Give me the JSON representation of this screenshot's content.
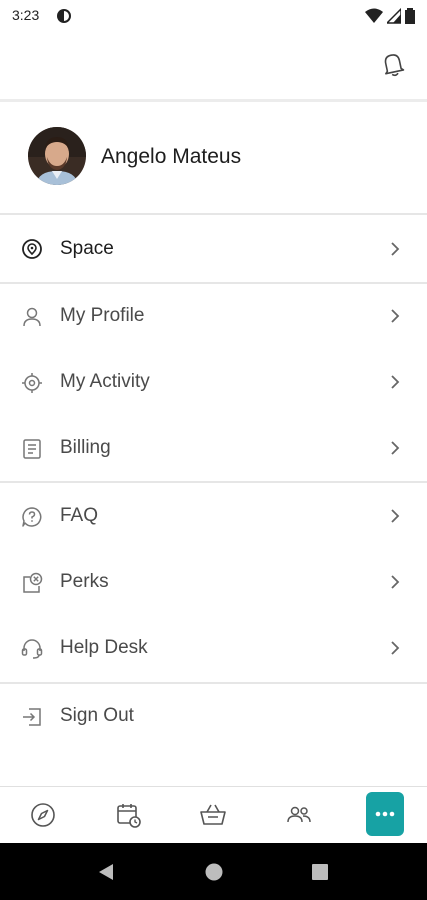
{
  "status_bar": {
    "time": "3:23"
  },
  "profile": {
    "name": "Angelo Mateus"
  },
  "menu": {
    "space": "Space",
    "my_profile": "My Profile",
    "my_activity": "My Activity",
    "billing": "Billing",
    "faq": "FAQ",
    "perks": "Perks",
    "help_desk": "Help Desk",
    "sign_out": "Sign Out"
  },
  "colors": {
    "accent": "#17a2a4",
    "divider": "#e6e6e6",
    "text": "#4a4a4a"
  },
  "icons": [
    "bell-icon",
    "location-pin-icon",
    "person-icon",
    "target-icon",
    "document-icon",
    "question-bubble-icon",
    "perks-tag-icon",
    "headset-icon",
    "sign-out-icon",
    "compass-icon",
    "calendar-clock-icon",
    "basket-icon",
    "people-icon",
    "more-dots-icon"
  ]
}
